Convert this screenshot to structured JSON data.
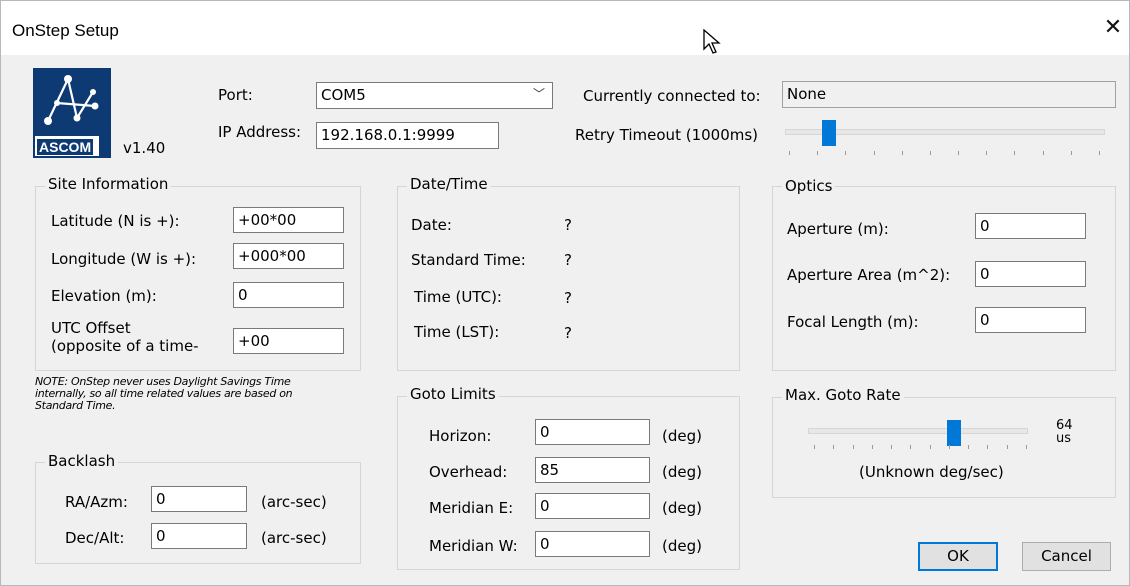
{
  "window": {
    "title": "OnStep Setup",
    "close_glyph": "✕"
  },
  "logo": {
    "brand": "ASCOM",
    "version": "v1.40"
  },
  "port": {
    "label": "Port:",
    "value": "COM5"
  },
  "ip": {
    "label": "IP Address:",
    "value": "192.168.0.1:9999"
  },
  "connection": {
    "label": "Currently connected to:",
    "value": "None"
  },
  "retry": {
    "label": "Retry Timeout (1000ms)",
    "level": 0.13
  },
  "site": {
    "title": "Site Information",
    "latitude_label": "Latitude (N is +):",
    "latitude": "+00*00",
    "longitude_label": "Longitude (W is +):",
    "longitude": "+000*00",
    "elevation_label": "Elevation (m):",
    "elevation": "0",
    "utc_label_1": "UTC Offset",
    "utc_label_2": "(opposite of a time-",
    "utc": "+00"
  },
  "note": {
    "line1": "NOTE: OnStep never uses Daylight Savings Time",
    "line2": "internally, so all time related values are based on",
    "line3": "Standard Time."
  },
  "backlash": {
    "title": "Backlash",
    "ra_label": "RA/Azm:",
    "ra": "0",
    "ra_unit": "(arc-sec)",
    "dec_label": "Dec/Alt:",
    "dec": "0",
    "dec_unit": "(arc-sec)"
  },
  "datetime": {
    "title": "Date/Time",
    "date_label": "Date:",
    "date": "?",
    "std_label": "Standard Time:",
    "std": "?",
    "utc_label": "Time (UTC):",
    "utc": "?",
    "lst_label": "Time (LST):",
    "lst": "?"
  },
  "goto_limits": {
    "title": "Goto Limits",
    "horizon_label": "Horizon:",
    "horizon": "0",
    "overhead_label": "Overhead:",
    "overhead": "85",
    "meridian_e_label": "Meridian E:",
    "meridian_e": "0",
    "meridian_w_label": "Meridian W:",
    "meridian_w": "0",
    "unit": "(deg)"
  },
  "optics": {
    "title": "Optics",
    "aperture_label": "Aperture (m):",
    "aperture": "0",
    "area_label": "Aperture Area (m^2):",
    "area": "0",
    "focal_label": "Focal Length (m):",
    "focal": "0"
  },
  "goto_rate": {
    "title": "Max. Goto Rate",
    "value": "64",
    "unit": "us",
    "status": "(Unknown deg/sec)",
    "level": 0.66
  },
  "buttons": {
    "ok": "OK",
    "cancel": "Cancel"
  }
}
